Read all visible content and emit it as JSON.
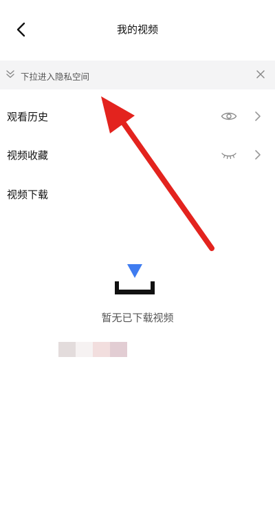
{
  "header": {
    "title": "我的视频",
    "back_icon": "chevron-left-icon"
  },
  "banner": {
    "icon": "double-chevron-down-icon",
    "text": "下拉进入隐私空间",
    "close_icon": "close-icon"
  },
  "list": {
    "items": [
      {
        "label": "观看历史",
        "trailing_icon": "eye-open-icon",
        "chevron": true
      },
      {
        "label": "视频收藏",
        "trailing_icon": "eye-closed-icon",
        "chevron": true
      },
      {
        "label": "视频下载"
      }
    ]
  },
  "empty_state": {
    "icon": "download-tray-icon",
    "text": "暂无已下载视频"
  },
  "colors": {
    "accent_blue": "#3f7cf0",
    "annotation_red": "#e3231e",
    "banner_bg": "#f4f4f5"
  }
}
